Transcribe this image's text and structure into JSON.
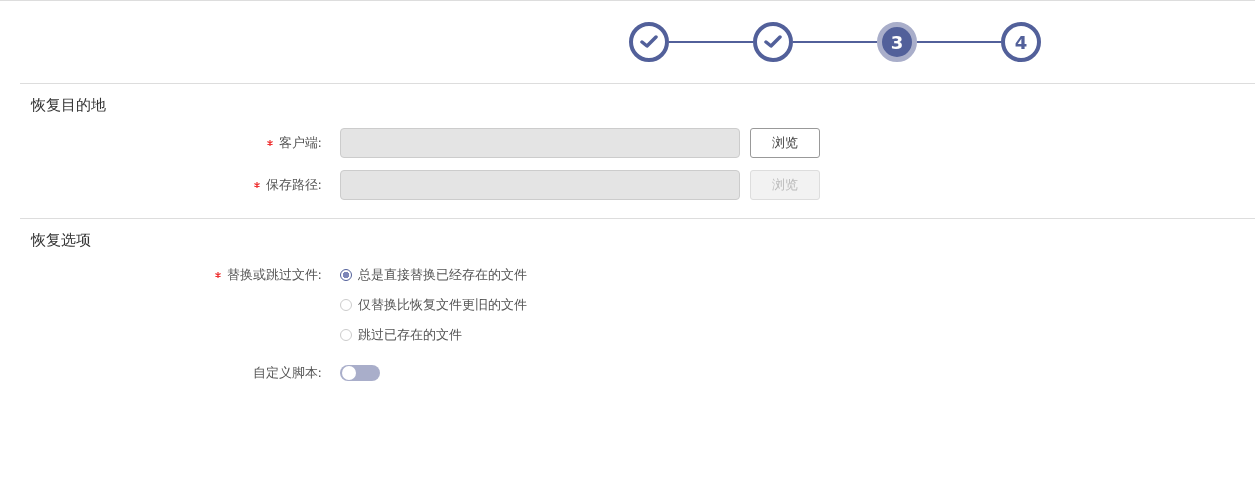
{
  "steps": [
    {
      "completed": true
    },
    {
      "completed": true
    },
    {
      "label": "3",
      "completed": false,
      "active": true
    },
    {
      "label": "4",
      "completed": false,
      "active": false
    }
  ],
  "sections": [
    {
      "title": "恢复目的地",
      "fields": [
        {
          "kind": "input",
          "label": "客户端:",
          "required": true,
          "button": {
            "label": "浏览",
            "disabled": false
          }
        },
        {
          "kind": "input",
          "label": "保存路径:",
          "required": true,
          "button": {
            "label": "浏览",
            "disabled": true
          }
        }
      ]
    },
    {
      "title": "恢复选项",
      "fields": [
        {
          "kind": "choice",
          "label": "替换或跳过文件:",
          "required": true,
          "options": [
            {
              "label": "总是直接替换已经存在的文件",
              "selected": true
            },
            {
              "label": "仅替换比恢复文件更旧的文件",
              "selected": false
            },
            {
              "label": "跳过已存在的文件",
              "selected": false
            }
          ]
        },
        {
          "kind": "switch",
          "label": "自定义脚本:",
          "required": false,
          "on": false
        }
      ]
    }
  ]
}
